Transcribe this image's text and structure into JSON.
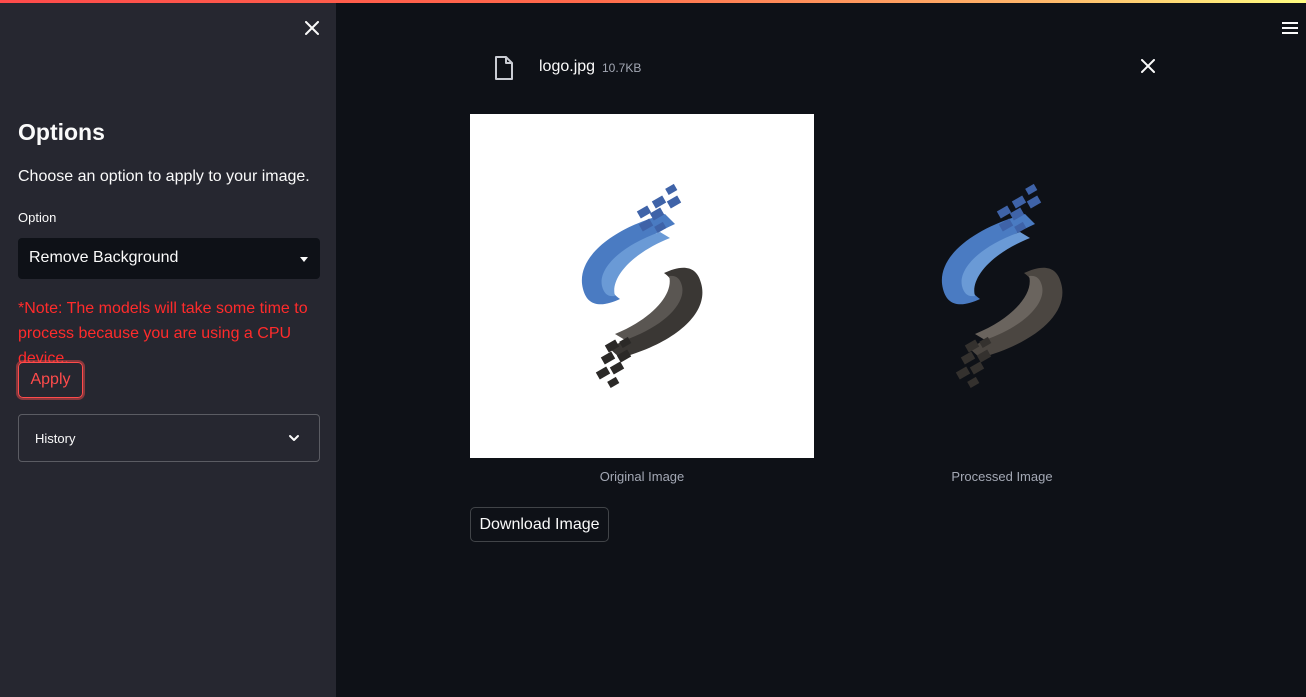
{
  "sidebar": {
    "title": "Options",
    "description": "Choose an option to apply to your image.",
    "option_label": "Option",
    "option_selected": "Remove Background",
    "note": "*Note: The models will take some time to process because you are using a CPU device.",
    "apply_label": "Apply",
    "history_label": "History"
  },
  "file": {
    "name": "logo.jpg",
    "size": "10.7KB"
  },
  "images": {
    "original_caption": "Original Image",
    "processed_caption": "Processed Image"
  },
  "download_label": "Download Image",
  "colors": {
    "accent": "#ff4b4b",
    "note": "#ff2b2b",
    "sidebar_bg": "#262730",
    "main_bg": "#0e1117",
    "logo_blue": "#4a7bc2",
    "logo_dark": "#3a3734"
  },
  "icons": {
    "sidebar_close": "close-icon",
    "menu": "hamburger-menu-icon",
    "file": "file-icon",
    "file_delete": "close-icon",
    "select_caret": "caret-down-icon",
    "expander": "chevron-down-icon"
  }
}
